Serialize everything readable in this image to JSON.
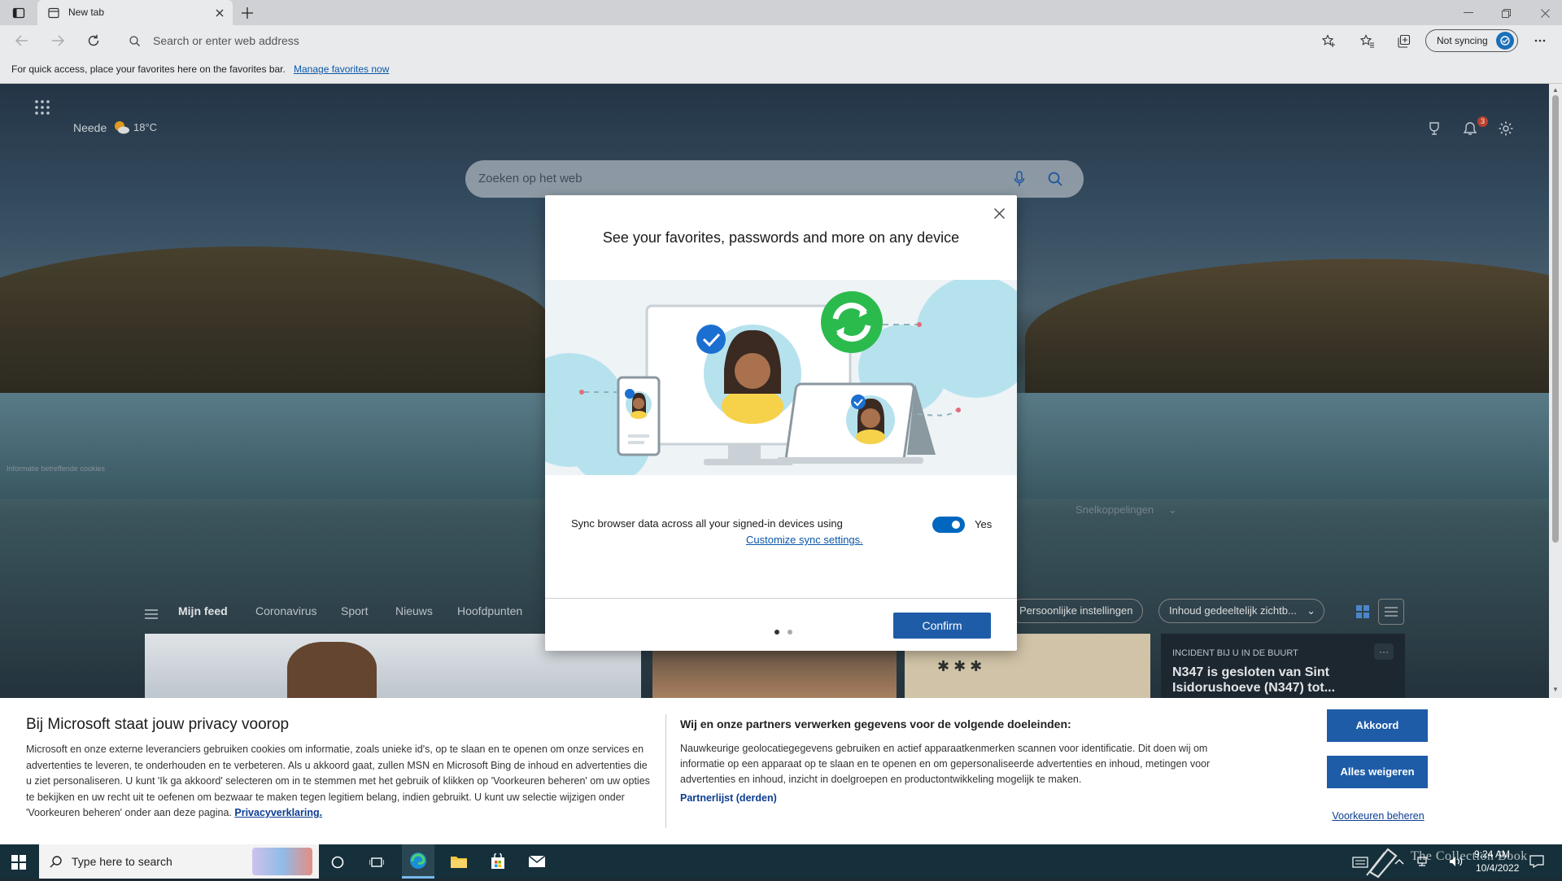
{
  "browser": {
    "tab_title": "New tab",
    "address_placeholder": "Search or enter web address",
    "sync_button": "Not syncing",
    "favbar_text": "For quick access, place your favorites here on the favorites bar.",
    "favbar_link": "Manage favorites now"
  },
  "newtab": {
    "location": "Neede",
    "temperature": "18",
    "temp_unit": "°C",
    "notification_count": "3",
    "search_placeholder": "Zoeken op het web",
    "shortcuts_label": "Snelkoppelingen",
    "cookie_info": "Informatie betreffende cookies",
    "feed_tabs": [
      "Mijn feed",
      "Coronavirus",
      "Sport",
      "Nieuws",
      "Hoofdpunten"
    ],
    "personal_settings": "Persoonlijke instellingen",
    "content_visibility": "Inhoud gedeeltelijk zichtb...",
    "card": {
      "tag": "INCIDENT BIJ U IN DE BUURT",
      "headline": "N347 is gesloten van Sint Isidorushoeve (N347) tot..."
    }
  },
  "dialog": {
    "title": "See your favorites, passwords and more on any device",
    "sync_text": "Sync browser data across all your signed-in devices using",
    "sync_link": "Customize sync settings.",
    "toggle_state": "Yes",
    "confirm": "Confirm"
  },
  "privacy": {
    "heading": "Bij Microsoft staat jouw privacy voorop",
    "body": "Microsoft en onze externe leveranciers gebruiken cookies om informatie, zoals unieke id's, op te slaan en te openen om onze services en advertenties te leveren, te onderhouden en te verbeteren. Als u akkoord gaat, zullen MSN en Microsoft Bing de inhoud en advertenties die u ziet personaliseren. U kunt 'Ik ga akkoord' selecteren om in te stemmen met het gebruik of klikken op 'Voorkeuren beheren' om uw opties te bekijken en uw recht uit te oefenen om bezwaar te maken tegen legitiem belang, indien gebruikt. U kunt uw selectie wijzigen onder 'Voorkeuren beheren' onder aan deze pagina.",
    "privacy_link": "Privacyverklaring.",
    "purposes_heading": "Wij en onze partners verwerken gegevens voor de volgende doeleinden:",
    "purposes_body": "Nauwkeurige geolocatiegegevens gebruiken en actief apparaatkenmerken scannen voor identificatie. Dit doen wij om informatie op een apparaat op te slaan en te openen en om gepersonaliseerde advertenties en inhoud, metingen voor advertenties en inhoud, inzicht in doelgroepen en productontwikkeling mogelijk te maken.",
    "partners_link": "Partnerlijst (derden)",
    "accept": "Akkoord",
    "reject": "Alles weigeren",
    "manage": "Voorkeuren beheren"
  },
  "taskbar": {
    "search_placeholder": "Type here to search",
    "time": "9:24 AM",
    "date": "10/4/2022",
    "watermark": "The Collection Book"
  },
  "colors": {
    "accent": "#1e5ca8",
    "link": "#0b57a8",
    "toggle": "#0067c0"
  }
}
